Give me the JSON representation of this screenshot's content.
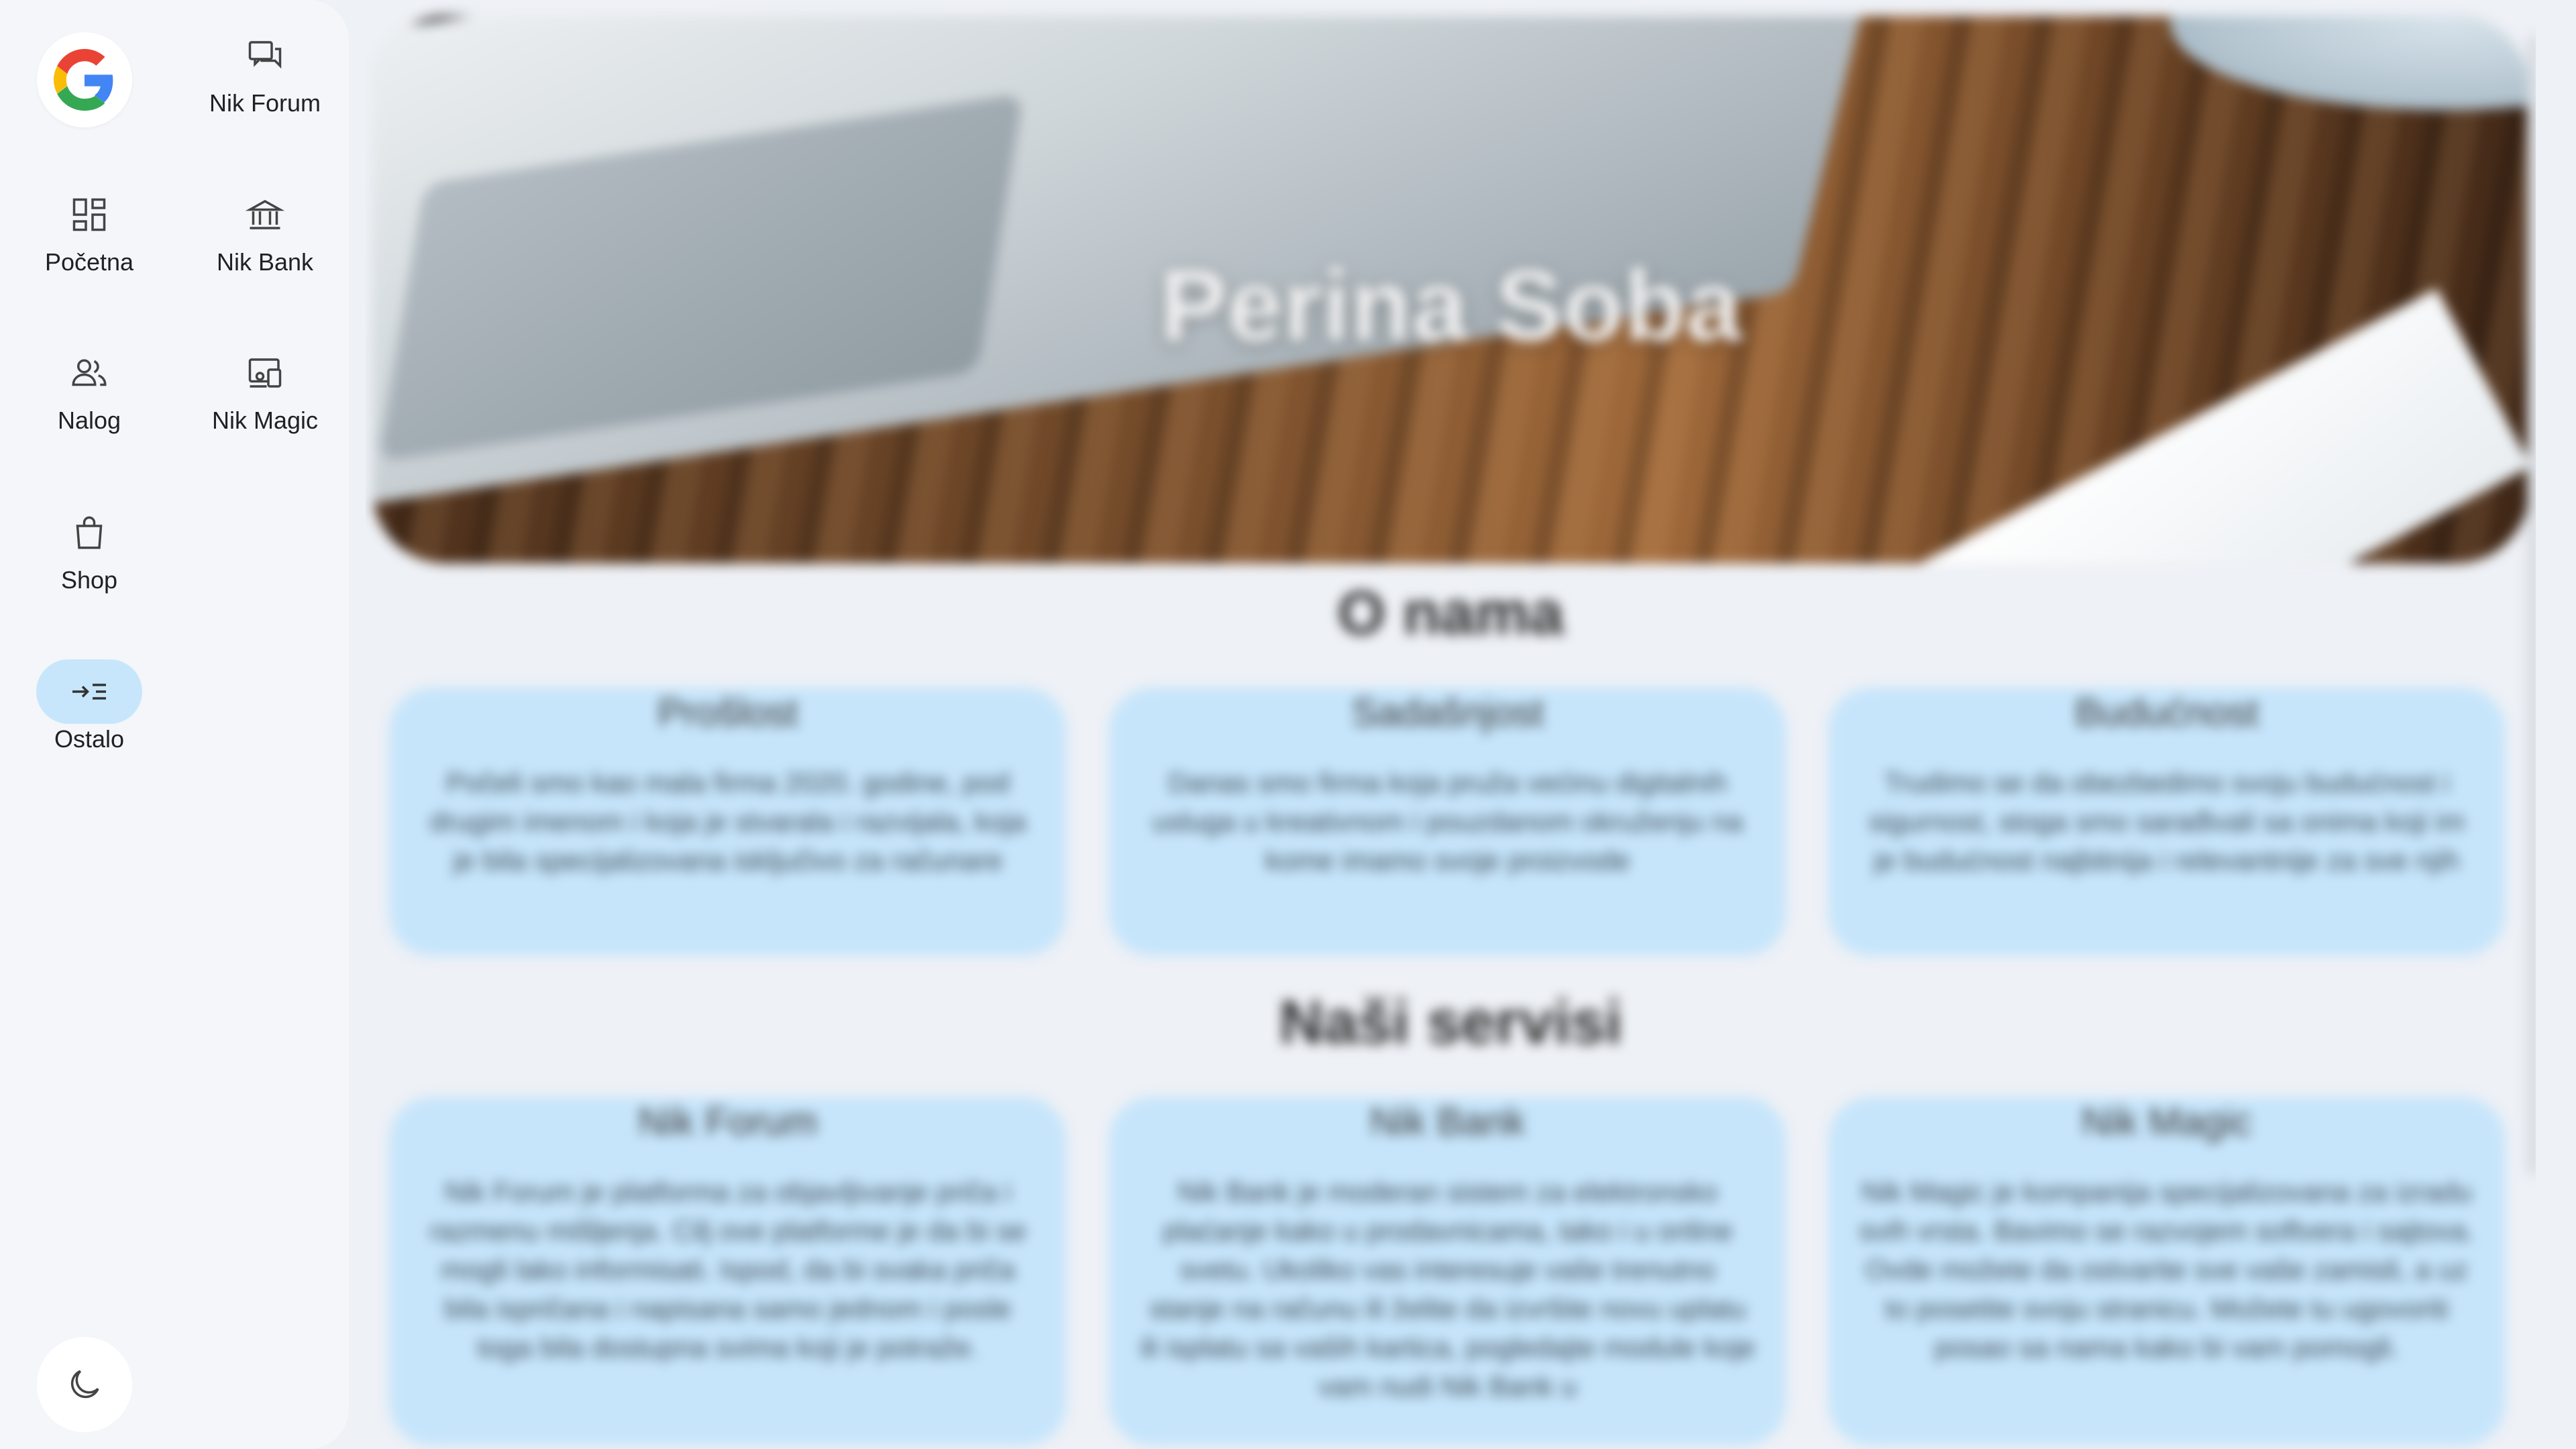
{
  "sidebar": {
    "logo": {
      "icon": "google-g-icon",
      "colors": [
        "#4285F4",
        "#EA4335",
        "#FBBC05",
        "#34A853"
      ]
    },
    "items": [
      {
        "label": "Nik Forum",
        "icon": "forum-icon"
      },
      {
        "label": "Početna",
        "icon": "dashboard-icon"
      },
      {
        "label": "Nik Bank",
        "icon": "bank-icon"
      },
      {
        "label": "Nalog",
        "icon": "account-icon"
      },
      {
        "label": "Nik Magic",
        "icon": "devices-icon"
      },
      {
        "label": "Shop",
        "icon": "shopping-bag-icon"
      },
      {
        "label": "Ostalo",
        "icon": "menu-open-icon",
        "active": true
      }
    ],
    "theme_toggle": {
      "icon": "dark-mode-moon-icon"
    },
    "active_color": "#c7e6fb"
  },
  "hero": {
    "title": "Perina Soba"
  },
  "about": {
    "title": "O nama",
    "cards": [
      {
        "title": "Prošlost",
        "text": "Počeli smo kao mala firma 2020. godine, pod drugim imenom i koja je stvarala i razvijala, koja je bila specijalizovana isključivo za računare"
      },
      {
        "title": "Sadašnjost",
        "text": "Danas smo firma koja pruža većinu digitalnih usluga u kreativnom i pouzdanom okruženju na kome imamo svoje proizvode"
      },
      {
        "title": "Budućnost",
        "text": "Trudimo se da obezbedimo svoju budućnost i sigurnost, stoga smo sarađivali sa onima koji im je budućnost najbitnija i relevantnije za sve njih"
      }
    ]
  },
  "services": {
    "title": "Naši servisi",
    "cards": [
      {
        "title": "Nik Forum",
        "text": "Nik Forum je platforma za objavljivanje priča i razmenu mišljenja. Cilj ove platforme je da bi se mogli lako informisati. Ispod, da bi svaka priča bila ispričana i napisana samo jednom i posle toga bila dostupna svima koji je potraže."
      },
      {
        "title": "Nik Bank",
        "text": "Nik Bank je moderan sistem za elektronsko plaćanje kako u prodavnicama, tako i u online svetu. Ukoliko vas interesuje vaše trenutno stanje na računu ili želite da izvršite novu uplatu ili isplatu sa vaših kartica, pogledajte module koje vam nudi Nik Bank u"
      },
      {
        "title": "Nik Magic",
        "text": "Nik Magic je kompanija specijalizovana za izradu svih vrsta. Bavimo se razvojem softvera i sajtova. Ovde možete da ostvarite sve vaše zamisli, a uz to posetite svoju stranicu. Možete tu ugovoriti posao sa nama kako bi vam pomogli."
      }
    ]
  }
}
